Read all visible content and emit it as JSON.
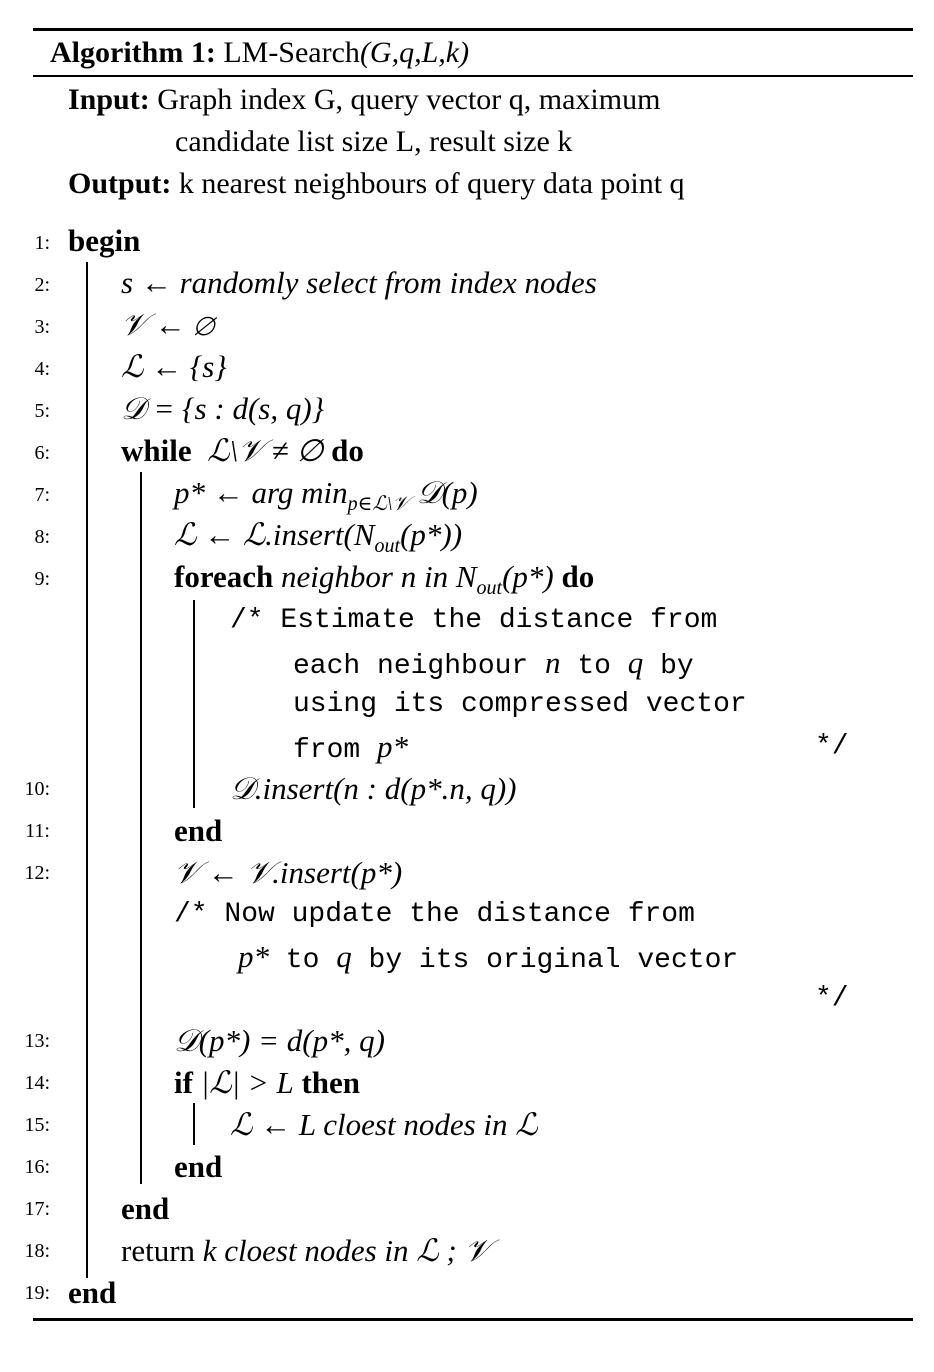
{
  "algorithm": {
    "label": "Algorithm 1:",
    "name": "LM-Search",
    "params": "(G,q,L,k)"
  },
  "input": {
    "label": "Input:",
    "line1": "Graph index G, query vector q, maximum",
    "line2": "candidate list size L, result size k"
  },
  "output": {
    "label": "Output:",
    "text": "k nearest neighbours of query data point q"
  },
  "lines": [
    {
      "no": "1:",
      "kw": "begin"
    },
    {
      "no": "2:",
      "text": "s ← randomly select from index nodes"
    },
    {
      "no": "3:",
      "text": "𝒱 ← ∅"
    },
    {
      "no": "4:",
      "text": "ℒ ← {s}"
    },
    {
      "no": "5:",
      "text": "𝒟 = {s : d(s, q)}"
    },
    {
      "no": "6:",
      "kw": "while",
      "text": "ℒ\\𝒱 ≠ ∅",
      "kw2": "do"
    },
    {
      "no": "7:",
      "pre": "p* ← arg min",
      "sub": "p∈ℒ\\𝒱",
      "post": " 𝒟(p)"
    },
    {
      "no": "8:",
      "pre": "ℒ ← ℒ.insert(N",
      "sub": "out",
      "post": "(p*))"
    },
    {
      "no": "9:",
      "kw": "foreach",
      "text": "neighbor n in N",
      "sub": "out",
      "post": "(p*)",
      "kw2": "do"
    },
    {
      "no": "10:",
      "text": "𝒟.insert(n : d(p*.n, q))"
    },
    {
      "no": "11:",
      "kw": "end"
    },
    {
      "no": "12:",
      "text": "𝒱 ← 𝒱.insert(p*)"
    },
    {
      "no": "13:",
      "text": "𝒟(p*) = d(p*, q)"
    },
    {
      "no": "14:",
      "kw": "if",
      "text": "|ℒ| > L",
      "kw2": "then"
    },
    {
      "no": "15:",
      "text": "ℒ ← L cloest nodes in ℒ"
    },
    {
      "no": "16:",
      "kw": "end"
    },
    {
      "no": "17:",
      "kw": "end"
    },
    {
      "no": "18:",
      "pre": "return",
      "text": "k cloest nodes in ℒ ; 𝒱"
    },
    {
      "no": "19:",
      "kw": "end"
    }
  ],
  "comments": {
    "c1": {
      "open": "/*",
      "l1": "Estimate the distance from",
      "l2a": "each neighbour ",
      "l2n": "n",
      "l2b": " to ",
      "l2q": "q",
      "l2c": " by",
      "l3": "using its compressed vector",
      "l4a": "from ",
      "l4p": "p*",
      "close": "*/"
    },
    "c2": {
      "open": "/*",
      "l1": "Now update the distance from",
      "l2p": "p*",
      "l2b": " to ",
      "l2q": "q",
      "l2c": " by its original vector",
      "close": "*/"
    }
  }
}
